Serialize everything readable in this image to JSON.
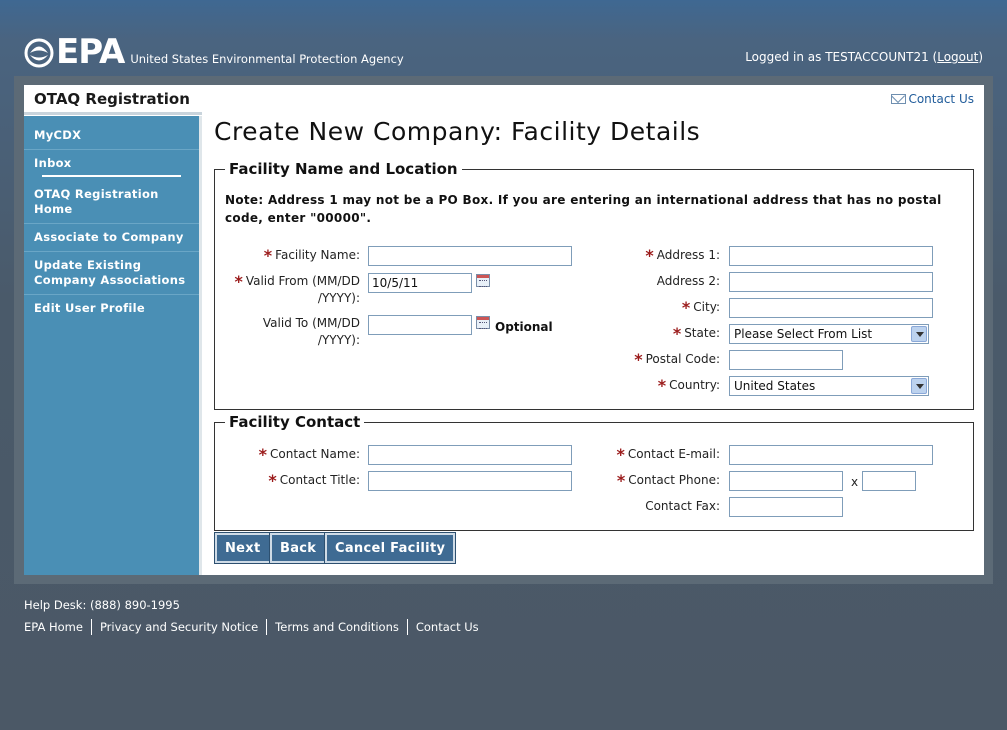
{
  "header": {
    "agency_short": "EPA",
    "agency_full": "United States Environmental Protection Agency",
    "logged_in_prefix": "Logged in as TESTACCOUNT21 (",
    "logout_label": "Logout",
    "logged_in_suffix": ")"
  },
  "sidebar": {
    "app_title": "OTAQ Registration",
    "items": [
      {
        "label": "MyCDX"
      },
      {
        "label": "Inbox"
      },
      {
        "label": "OTAQ Registration Home"
      },
      {
        "label": "Associate to Company"
      },
      {
        "label": "Update Existing Company Associations"
      },
      {
        "label": "Edit User Profile"
      }
    ]
  },
  "main": {
    "contact_us": "Contact Us",
    "title": "Create New Company: Facility Details",
    "section1": {
      "legend": "Facility Name and Location",
      "note": "Note: Address 1 may not be a PO Box. If you are entering an international address that has no postal code, enter \"00000\".",
      "facility_name_label": "Facility Name:",
      "valid_from_label_1": "Valid From (MM/DD",
      "valid_from_label_2": "/YYYY):",
      "valid_from_value": "10/5/11",
      "valid_to_label_1": "Valid To (MM/DD",
      "valid_to_label_2": "/YYYY):",
      "optional": "Optional",
      "address1_label": "Address 1:",
      "address2_label": "Address 2:",
      "city_label": "City:",
      "state_label": "State:",
      "state_value": "Please Select From List",
      "postal_label": "Postal Code:",
      "country_label": "Country:",
      "country_value": "United States"
    },
    "section2": {
      "legend": "Facility Contact",
      "contact_name_label": "Contact Name:",
      "contact_title_label": "Contact Title:",
      "contact_email_label": "Contact E-mail:",
      "contact_phone_label": "Contact Phone:",
      "phone_ext_sep": "x",
      "contact_fax_label": "Contact Fax:"
    },
    "buttons": {
      "next": "Next",
      "back": "Back",
      "cancel": "Cancel Facility"
    }
  },
  "footer": {
    "help_desk": "Help Desk: (888) 890-1995",
    "links": [
      "EPA Home",
      "Privacy and Security Notice",
      "Terms and Conditions",
      "Contact Us"
    ]
  },
  "colors": {
    "sidebar_bg": "#4a8fb5",
    "button_bg": "#3f6b93",
    "required_star": "#9b1b1b",
    "link": "#1f5b9a"
  }
}
